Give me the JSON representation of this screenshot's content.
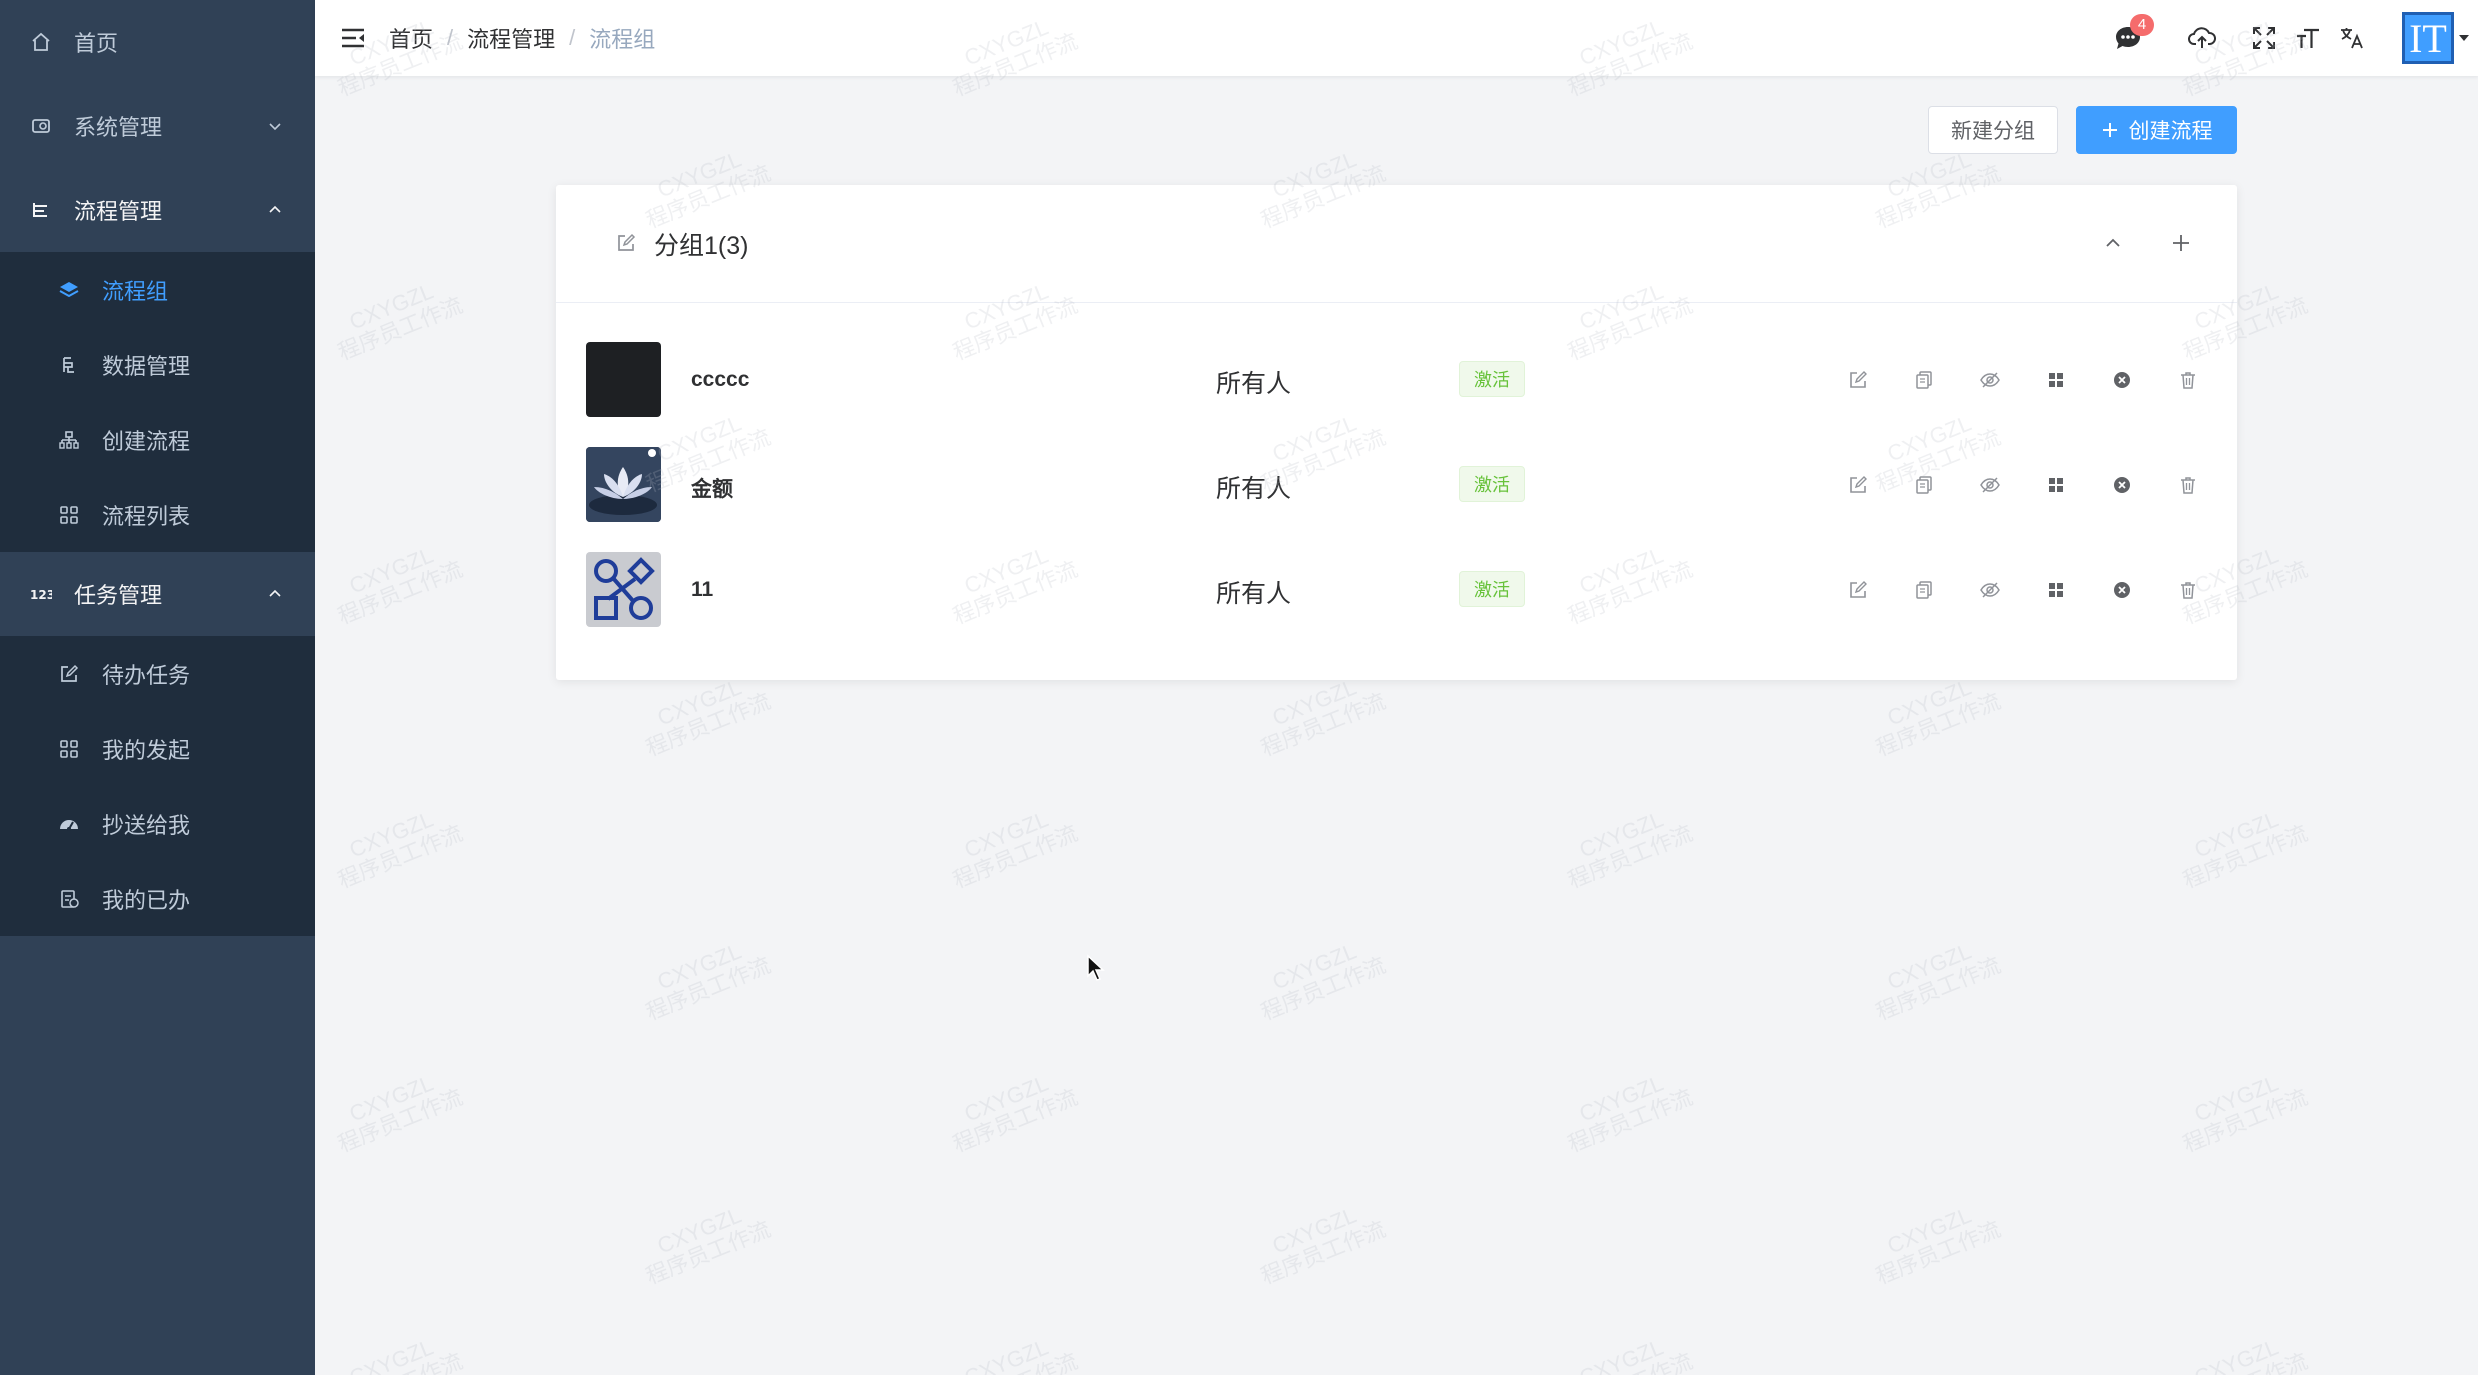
{
  "sidebar": {
    "home": "首页",
    "system": "系统管理",
    "process": "流程管理",
    "process_items": [
      {
        "label": "流程组",
        "icon": "layers-icon",
        "active": true
      },
      {
        "label": "数据管理",
        "icon": "data-icon",
        "active": false
      },
      {
        "label": "创建流程",
        "icon": "hierarchy-icon",
        "active": false
      },
      {
        "label": "流程列表",
        "icon": "grid-icon",
        "active": false
      }
    ],
    "task": "任务管理",
    "task_items": [
      {
        "label": "待办任务",
        "icon": "edit-icon"
      },
      {
        "label": "我的发起",
        "icon": "grid-icon"
      },
      {
        "label": "抄送给我",
        "icon": "dashboard-icon"
      },
      {
        "label": "我的已办",
        "icon": "done-icon"
      }
    ]
  },
  "header": {
    "breadcrumb": [
      "首页",
      "流程管理",
      "流程组"
    ],
    "separator": "/",
    "notify_count": "4",
    "avatar_text": "IT"
  },
  "toolbar": {
    "new_group": "新建分组",
    "create_process": "创建流程"
  },
  "group": {
    "title": "分组1(3)",
    "rows": [
      {
        "name": "ccccc",
        "owner": "所有人",
        "status": "激活",
        "thumb": "dark"
      },
      {
        "name": "金额",
        "owner": "所有人",
        "status": "激活",
        "thumb": "lotus"
      },
      {
        "name": "11",
        "owner": "所有人",
        "status": "激活",
        "thumb": "shapes"
      }
    ]
  },
  "watermark": {
    "line1": "CXYGZL",
    "line2": "程序员工作流"
  },
  "colors": {
    "sidebar_bg": "#304156",
    "submenu_bg": "#1f2d3d",
    "primary": "#409eff",
    "success": "#67c23a",
    "danger": "#f56c6c"
  }
}
